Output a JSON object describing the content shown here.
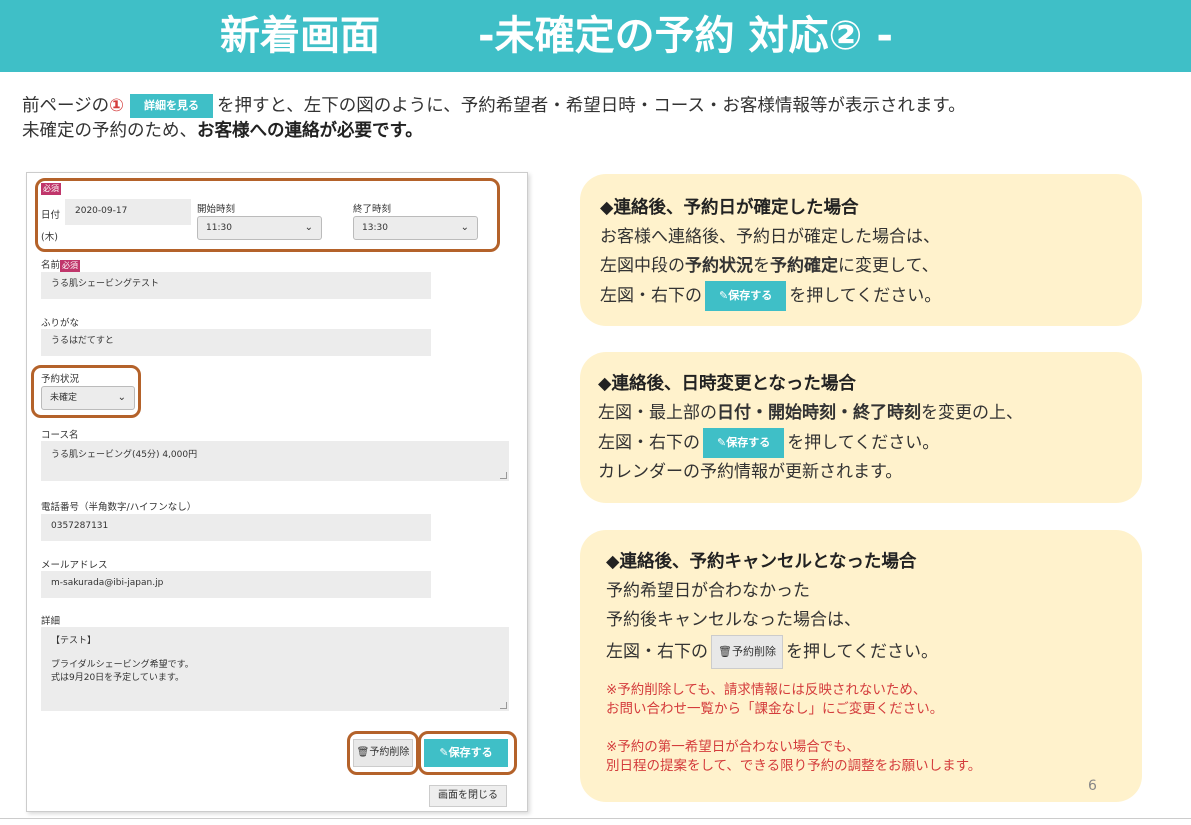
{
  "header": {
    "title_main": "新着画面",
    "title_sub": "-未確定の予約 対応② -"
  },
  "intro": {
    "prefix": "前ページの",
    "num": "①",
    "button_label": "詳細を見る",
    "line1_rest": "を押すと、左下の図のように、予約希望者・希望日時・コース・お客様情報等が表示されます。",
    "line2_plain": "未確定の予約のため、",
    "line2_bold": "お客様への連絡が必要です。"
  },
  "form": {
    "required_badge": "必須",
    "date_label": "日付",
    "date_value": "2020-09-17",
    "weekday": "(木)",
    "start_label": "開始時刻",
    "start_value": "11:30",
    "end_label": "終了時刻",
    "end_value": "13:30",
    "name_label": "名前",
    "name_value": "うる肌シェービングテスト",
    "furigana_label": "ふりがな",
    "furigana_value": "うるはだてすと",
    "status_label": "予約状況",
    "status_value": "未確定",
    "course_label": "コース名",
    "course_value": "うる肌シェービング(45分) 4,000円",
    "phone_label": "電話番号（半角数字/ハイフンなし）",
    "phone_value": "0357287131",
    "email_label": "メールアドレス",
    "email_value": "m-sakurada@ibi-japan.jp",
    "detail_label": "詳細",
    "detail_line1": "【テスト】",
    "detail_line2": "ブライダルシェービング希望です。",
    "detail_line3": "式は9月20日を予定しています。",
    "delete_button": "予約削除",
    "save_button": "保存する",
    "close_button": "画面を閉じる"
  },
  "card1": {
    "heading": "◆連絡後、予約日が確定した場合",
    "line1": "お客様へ連絡後、予約日が確定した場合は、",
    "line2_a": "左図中段の",
    "line2_b": "予約状況",
    "line2_c": "を",
    "line2_d": "予約確定",
    "line2_e": "に変更して、",
    "line3_a": "左図・右下の",
    "save_label": "保存する",
    "line3_b": "を押してください。"
  },
  "card2": {
    "heading": "◆連絡後、日時変更となった場合",
    "line1_a": "左図・最上部の",
    "line1_b": "日付・開始時刻・終了時刻",
    "line1_c": "を変更の上、",
    "line2_a": "左図・右下の",
    "save_label": "保存する",
    "line2_b": "を押してください。",
    "line3": "カレンダーの予約情報が更新されます。"
  },
  "card3": {
    "heading": "◆連絡後、予約キャンセルとなった場合",
    "line1": "予約希望日が合わなかった",
    "line2": "予約後キャンセルなった場合は、",
    "line3_a": "左図・右下の",
    "delete_label": "予約削除",
    "line3_b": "を押してください。",
    "note1": "※予約削除しても、請求情報には反映されないため、",
    "note2": "お問い合わせ一覧から「課金なし」にご変更ください。",
    "note3": "※予約の第一希望日が合わない場合でも、",
    "note4": "別日程の提案をして、できる限り予約の調整をお願いします。"
  },
  "page_number": "6",
  "colors": {
    "accent": "#3fbfc7",
    "highlight": "#b4622a",
    "card_bg": "#fff2cc",
    "note_red": "#d43c3c"
  },
  "icons": [
    "pencil-icon",
    "trash-icon",
    "chevron-down-icon"
  ]
}
